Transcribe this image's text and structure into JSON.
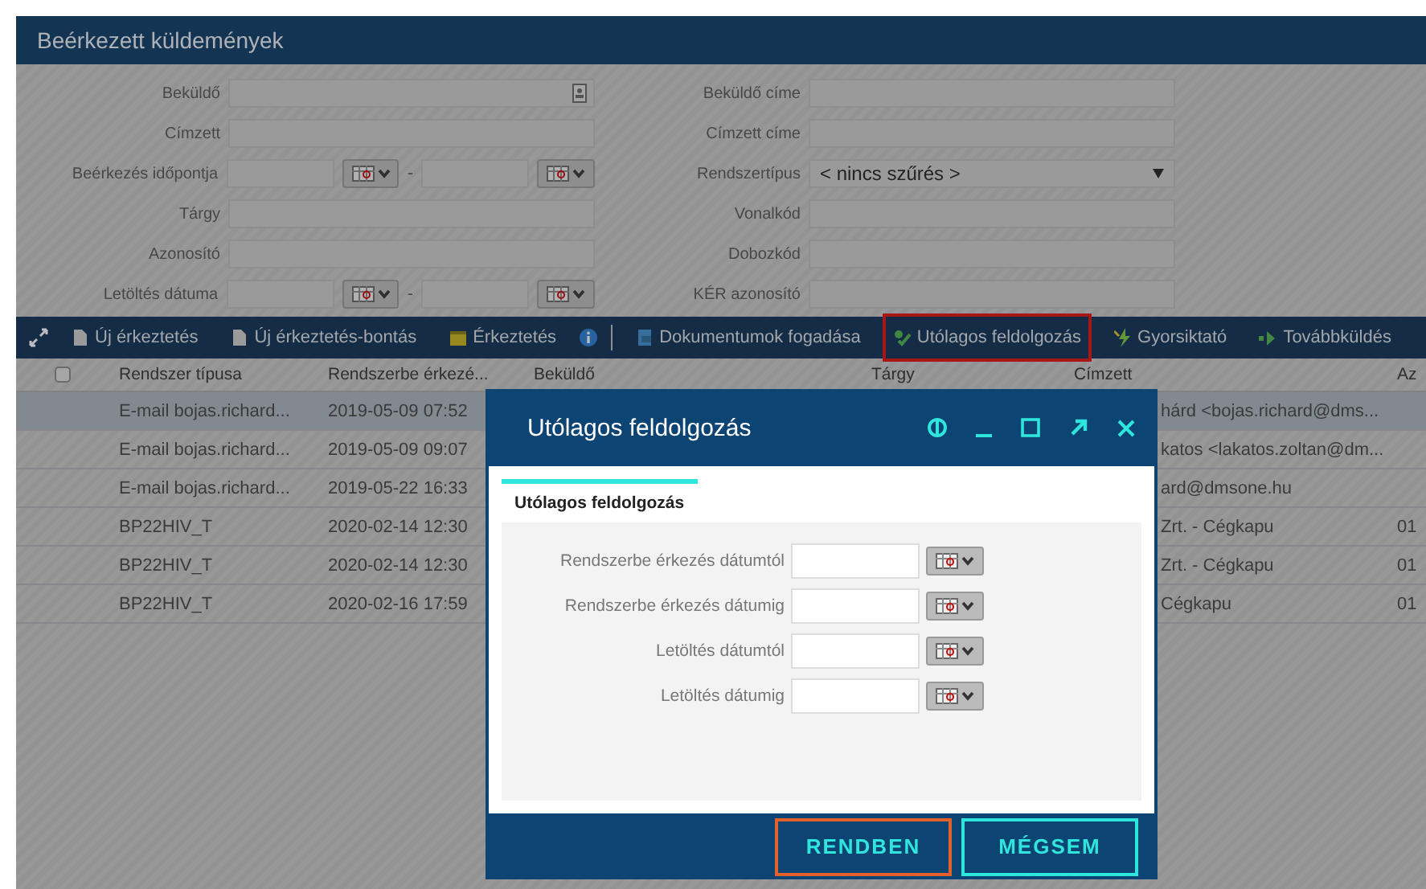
{
  "window": {
    "title": "Beérkezett küldemények"
  },
  "filters": {
    "left": [
      {
        "label": "Beküldő",
        "kind": "lookup"
      },
      {
        "label": "Címzett",
        "kind": "text"
      },
      {
        "label": "Beérkezés időpontja",
        "kind": "daterange",
        "separator": "-"
      },
      {
        "label": "Tárgy",
        "kind": "text"
      },
      {
        "label": "Azonosító",
        "kind": "text"
      },
      {
        "label": "Letöltés dátuma",
        "kind": "daterange",
        "separator": "-"
      }
    ],
    "right": [
      {
        "label": "Beküldő címe",
        "kind": "text"
      },
      {
        "label": "Címzett címe",
        "kind": "text"
      },
      {
        "label": "Rendszertípus",
        "kind": "select",
        "value": "< nincs szűrés >"
      },
      {
        "label": "Vonalkód",
        "kind": "text"
      },
      {
        "label": "Dobozkód",
        "kind": "text"
      },
      {
        "label": "KÉR azonosító",
        "kind": "text"
      }
    ]
  },
  "toolbar": [
    {
      "kind": "expand"
    },
    {
      "kind": "doc",
      "label": "Új érkeztetés",
      "highlighted": false
    },
    {
      "kind": "doc",
      "label": "Új érkeztetés-bontás",
      "highlighted": false
    },
    {
      "kind": "note",
      "label": "Érkeztetés",
      "highlighted": false
    },
    {
      "kind": "info"
    },
    {
      "kind": "separator"
    },
    {
      "kind": "docs",
      "label": "Dokumentumok fogadása",
      "highlighted": false
    },
    {
      "kind": "check",
      "label": "Utólagos feldolgozás",
      "highlighted": true
    },
    {
      "kind": "bolt",
      "label": "Gyorsiktató",
      "highlighted": false
    },
    {
      "kind": "forward",
      "label": "Továbbküldés",
      "highlighted": false
    }
  ],
  "table": {
    "select_all": {
      "checked": false
    },
    "columns": [
      "Rendszer típusa",
      "Rendszerbe érkezé...",
      "Beküldő",
      "Tárgy",
      "Címzett",
      "Az"
    ],
    "rows": [
      {
        "selected": true,
        "cells": [
          "E-mail bojas.richard...",
          "2019-05-09 07:52",
          "hárd <bojas.richard@dms..."
        ]
      },
      {
        "selected": false,
        "cells": [
          "E-mail bojas.richard...",
          "2019-05-09 09:07",
          "katos <lakatos.zoltan@dm..."
        ]
      },
      {
        "selected": false,
        "cells": [
          "E-mail bojas.richard...",
          "2019-05-22 16:33",
          "ard@dmsone.hu"
        ]
      },
      {
        "selected": false,
        "cells": [
          "BP22HIV_T",
          "2020-02-14 12:30",
          "Zrt. - Cégkapu",
          "01"
        ]
      },
      {
        "selected": false,
        "cells": [
          "BP22HIV_T",
          "2020-02-14 12:30",
          "Zrt. - Cégkapu",
          "01"
        ]
      },
      {
        "selected": false,
        "cells": [
          "BP22HIV_T",
          "2020-02-16 17:59",
          "Cégkapu",
          "01"
        ]
      }
    ]
  },
  "dialog": {
    "title": "Utólagos feldolgozás",
    "tabs": [
      {
        "label": "Utólagos feldolgozás",
        "selected": true
      }
    ],
    "fields": [
      "Rendszerbe érkezés dátumtól",
      "Rendszerbe érkezés dátumig",
      "Letöltés dátumtól",
      "Letöltés dátumig"
    ],
    "buttons": [
      {
        "label": "RENDBEN",
        "kind": "primary"
      },
      {
        "label": "MÉGSEM",
        "kind": "secondary"
      }
    ]
  }
}
